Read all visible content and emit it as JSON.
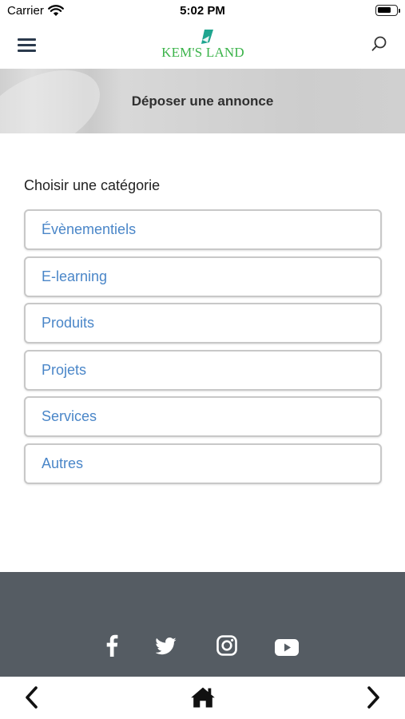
{
  "status_bar": {
    "carrier": "Carrier",
    "time": "5:02 PM"
  },
  "header": {
    "logo_text": "KEM'S LAND",
    "brand_color": "#3bb34a",
    "logo_mark_color": "#1fa58f"
  },
  "hero": {
    "title": "Déposer une annonce"
  },
  "main": {
    "section_label": "Choisir une catégorie",
    "categories": [
      {
        "label": "Évènementiels"
      },
      {
        "label": "E-learning"
      },
      {
        "label": "Produits"
      },
      {
        "label": "Projets"
      },
      {
        "label": "Services"
      },
      {
        "label": "Autres"
      }
    ],
    "link_color": "#4a86c8"
  },
  "footer": {
    "background": "#555c63",
    "social_icons": [
      "facebook-icon",
      "twitter-icon",
      "instagram-icon",
      "youtube-icon"
    ]
  },
  "bottom_nav": {
    "icons": [
      "chevron-left-icon",
      "home-icon",
      "chevron-right-icon"
    ]
  }
}
